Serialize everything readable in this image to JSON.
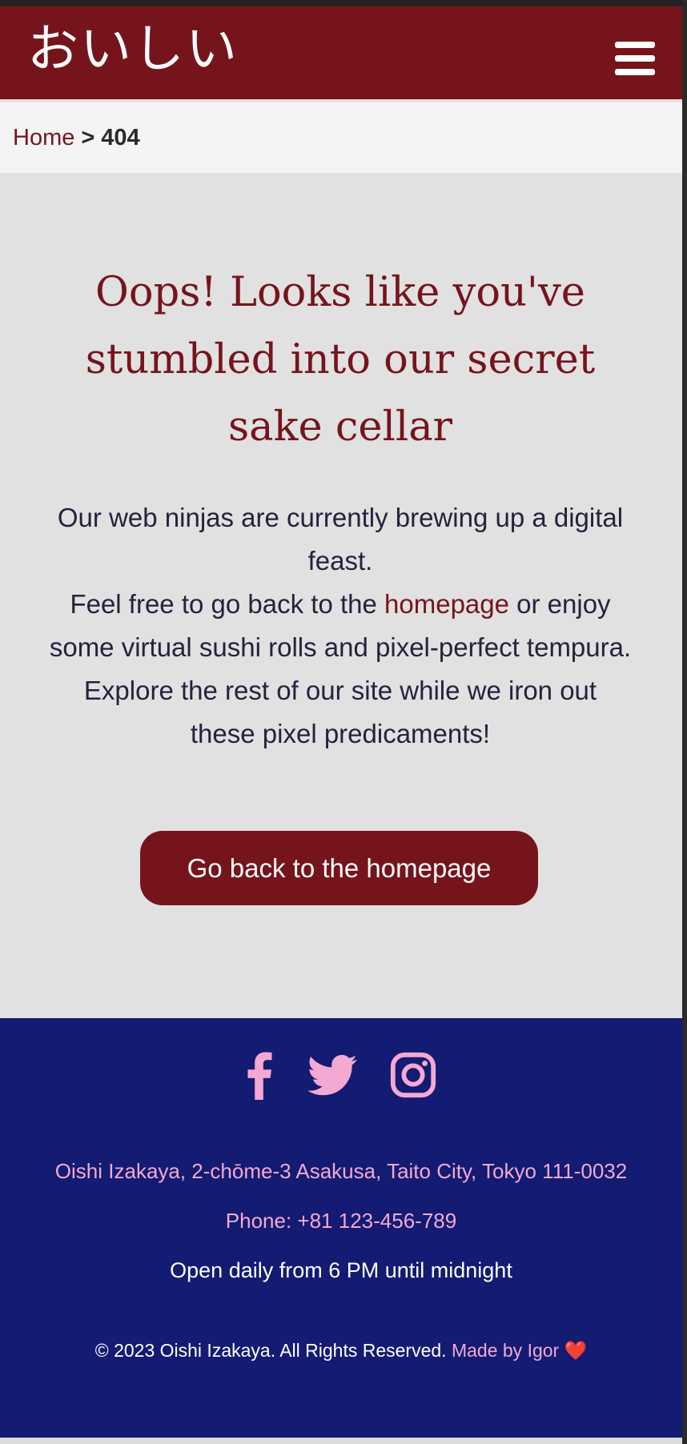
{
  "navbar": {
    "logo": "おいしい",
    "menu_icon": "hamburger-menu-icon"
  },
  "breadcrumb": {
    "home": "Home",
    "separator": ">",
    "current": "404"
  },
  "main": {
    "heading": "Oops! Looks like you've stumbled into our secret sake cellar",
    "paragraph1": "Our web ninjas are currently brewing up a digital feast.",
    "paragraph2_before": "Feel free to go back to the ",
    "paragraph2_link": "homepage",
    "paragraph2_after": " or enjoy some virtual sushi rolls and pixel-perfect tempura.",
    "paragraph3": "Explore the rest of our site while we iron out these pixel predicaments!",
    "button_label": "Go back to the homepage"
  },
  "footer": {
    "social": [
      {
        "icon": "facebook-icon"
      },
      {
        "icon": "twitter-icon"
      },
      {
        "icon": "instagram-icon"
      }
    ],
    "address": "Oishi Izakaya, 2-chōme-3 Asakusa, Taito City, Tokyo 111-0032",
    "phone": "Phone: +81 123-456-789",
    "hours": "Open daily from 6 PM until midnight",
    "copyright": "© 2023 Oishi Izakaya. All Rights Reserved.",
    "made_by": "Made by Igor",
    "heart": "❤️"
  },
  "colors": {
    "brand_red": "#76141c",
    "footer_navy": "#131b72",
    "footer_pink": "#f3a9d1",
    "text_dark": "#23233e",
    "main_bg": "#e1e1e1"
  }
}
